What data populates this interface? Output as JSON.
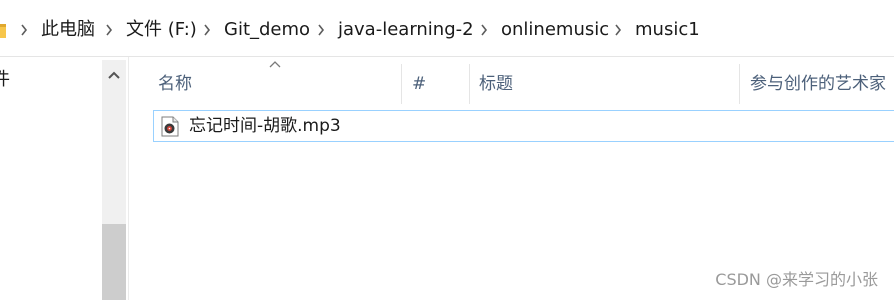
{
  "address_bar": {
    "folder_icon": "folder-icon",
    "separator_icon": "chevron-right-icon",
    "breadcrumbs": [
      "此电脑",
      "文件 (F:)",
      "Git_demo",
      "java-learning-2",
      "onlinemusic",
      "music1"
    ]
  },
  "nav_pane": {
    "partial_item_label": "件",
    "scrollbar": {
      "up_arrow_icon": "chevron-up-icon"
    }
  },
  "file_list": {
    "sort_indicator_icon": "sort-ascending-icon",
    "columns": [
      "名称",
      "#",
      "标题",
      "参与创作的艺术家"
    ],
    "files": [
      {
        "name": "忘记时间-胡歌.mp3",
        "icon": "mp3-audio-file-icon"
      }
    ]
  },
  "watermark": "CSDN @来学习的小张",
  "colors": {
    "column_header_text": "#4c607a",
    "row_border": "#99d1ff",
    "scrollbar_track": "#f0f0f0",
    "scrollbar_thumb": "#cdcdcd",
    "folder_yellow": "#f7c64b",
    "watermark_text": "#9a9a9a"
  }
}
